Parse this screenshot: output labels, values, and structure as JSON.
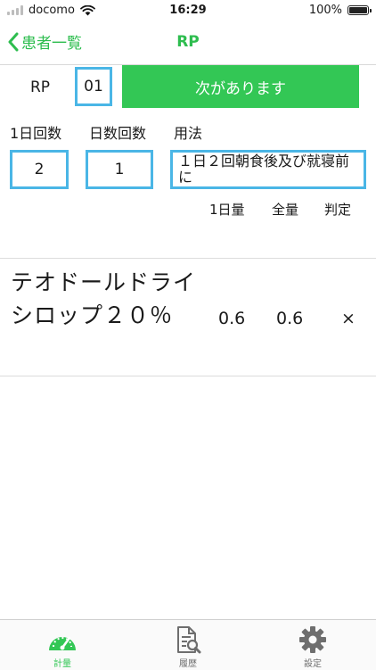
{
  "status": {
    "carrier": "docomo",
    "time": "16:29",
    "battery": "100%"
  },
  "nav": {
    "back_label": "患者一覧",
    "title": "RP"
  },
  "rp": {
    "label": "RP",
    "number": "01",
    "next_button": "次があります"
  },
  "fields": {
    "daily_count_label": "1日回数",
    "days_count_label": "日数回数",
    "usage_label": "用法",
    "daily_count_value": "2",
    "days_count_value": "1",
    "usage_value": "１日２回朝食後及び就寝前に"
  },
  "columns": {
    "daily_amount": "1日量",
    "total_amount": "全量",
    "judgement": "判定"
  },
  "drugs": [
    {
      "name": "テオドールドライシロップ２０％",
      "daily_amount": "0.6",
      "total_amount": "0.6",
      "judgement": "×"
    }
  ],
  "tabs": [
    {
      "label": "計量",
      "active": true
    },
    {
      "label": "履歴",
      "active": false
    },
    {
      "label": "設定",
      "active": false
    }
  ],
  "colors": {
    "accent": "#33c755",
    "field_border": "#4ab6e6",
    "inactive_tab": "#6e6e6e"
  }
}
